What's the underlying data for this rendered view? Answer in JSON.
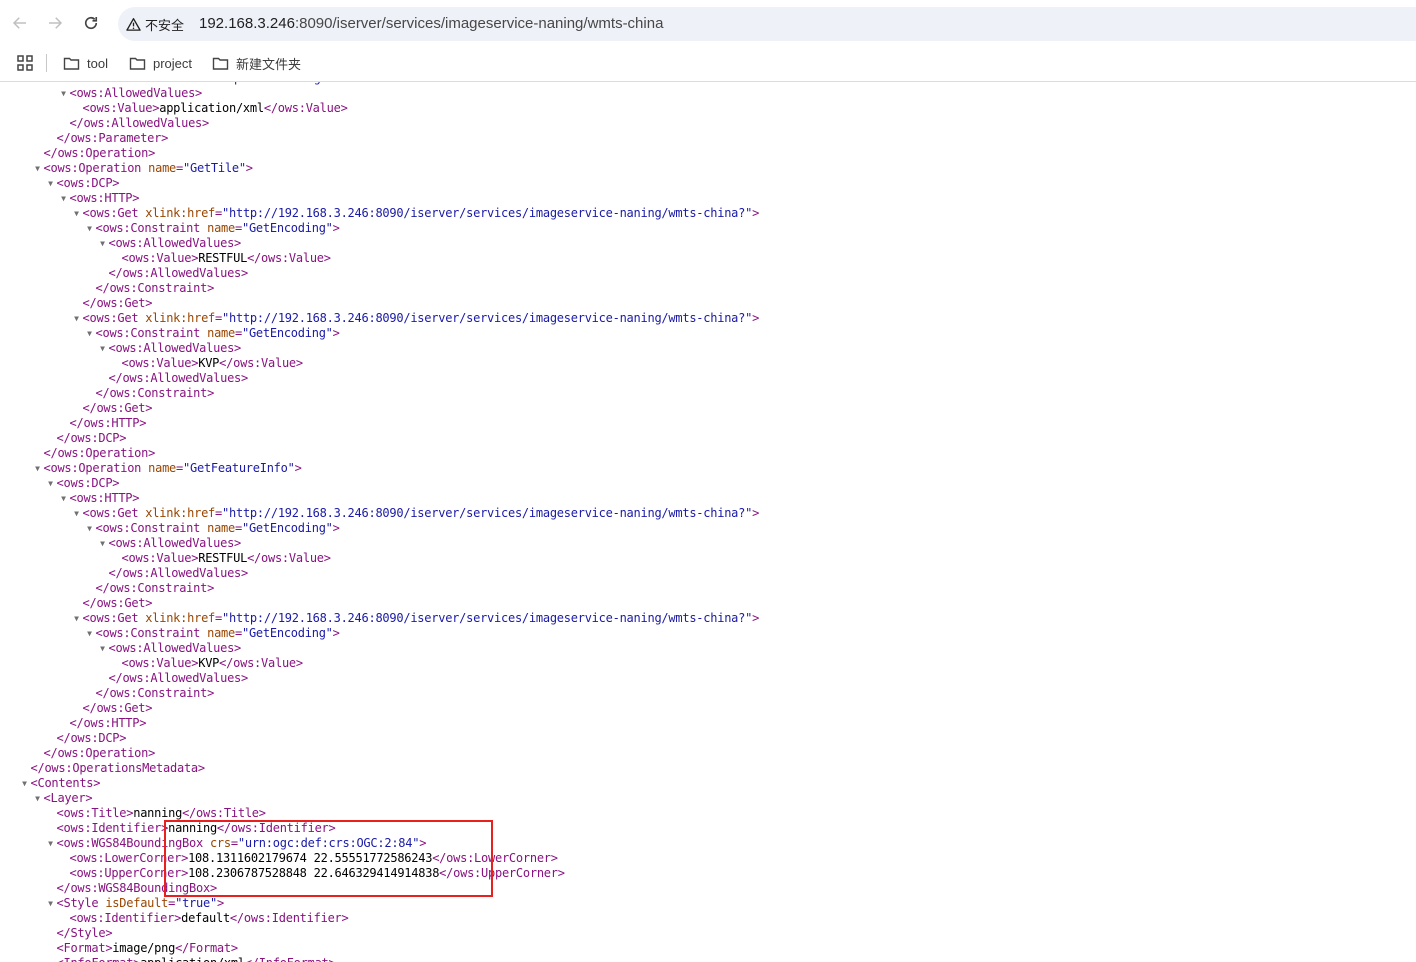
{
  "browser": {
    "security_label": "不安全",
    "url_host": "192.168.3.246",
    "url_path": ":8090/iserver/services/imageservice-naning/wmts-china",
    "bookmarks": [
      {
        "label": "tool"
      },
      {
        "label": "project"
      },
      {
        "label": "新建文件夹"
      }
    ]
  },
  "xml_lines": [
    {
      "indent": 5,
      "toggle": "",
      "parts": [
        [
          "tg",
          "<ows:Parameter "
        ],
        [
          "an",
          "name"
        ],
        [
          "tg",
          "="
        ],
        [
          "av",
          "\"RequestEncoding\""
        ],
        [
          "tg",
          ">"
        ]
      ]
    },
    {
      "indent": 5,
      "toggle": "▼",
      "parts": [
        [
          "tg",
          "<ows:AllowedValues>"
        ]
      ]
    },
    {
      "indent": 6,
      "toggle": "",
      "parts": [
        [
          "tg",
          "<ows:Value>"
        ],
        [
          "tx",
          "application/xml"
        ],
        [
          "tg",
          "</ows:Value>"
        ]
      ]
    },
    {
      "indent": 5,
      "toggle": "",
      "parts": [
        [
          "tg",
          "</ows:AllowedValues>"
        ]
      ]
    },
    {
      "indent": 4,
      "toggle": "",
      "parts": [
        [
          "tg",
          "</ows:Parameter>"
        ]
      ]
    },
    {
      "indent": 3,
      "toggle": "",
      "parts": [
        [
          "tg",
          "</ows:Operation>"
        ]
      ]
    },
    {
      "indent": 3,
      "toggle": "▼",
      "parts": [
        [
          "tg",
          "<ows:Operation "
        ],
        [
          "an",
          "name"
        ],
        [
          "tg",
          "="
        ],
        [
          "av",
          "\"GetTile\""
        ],
        [
          "tg",
          ">"
        ]
      ]
    },
    {
      "indent": 4,
      "toggle": "▼",
      "parts": [
        [
          "tg",
          "<ows:DCP>"
        ]
      ]
    },
    {
      "indent": 5,
      "toggle": "▼",
      "parts": [
        [
          "tg",
          "<ows:HTTP>"
        ]
      ]
    },
    {
      "indent": 6,
      "toggle": "▼",
      "parts": [
        [
          "tg",
          "<ows:Get "
        ],
        [
          "an",
          "xlink:href"
        ],
        [
          "tg",
          "="
        ],
        [
          "av",
          "\"http://192.168.3.246:8090/iserver/services/imageservice-naning/wmts-china?\""
        ],
        [
          "tg",
          ">"
        ]
      ]
    },
    {
      "indent": 7,
      "toggle": "▼",
      "parts": [
        [
          "tg",
          "<ows:Constraint "
        ],
        [
          "an",
          "name"
        ],
        [
          "tg",
          "="
        ],
        [
          "av",
          "\"GetEncoding\""
        ],
        [
          "tg",
          ">"
        ]
      ]
    },
    {
      "indent": 8,
      "toggle": "▼",
      "parts": [
        [
          "tg",
          "<ows:AllowedValues>"
        ]
      ]
    },
    {
      "indent": 9,
      "toggle": "",
      "parts": [
        [
          "tg",
          "<ows:Value>"
        ],
        [
          "tx",
          "RESTFUL"
        ],
        [
          "tg",
          "</ows:Value>"
        ]
      ]
    },
    {
      "indent": 8,
      "toggle": "",
      "parts": [
        [
          "tg",
          "</ows:AllowedValues>"
        ]
      ]
    },
    {
      "indent": 7,
      "toggle": "",
      "parts": [
        [
          "tg",
          "</ows:Constraint>"
        ]
      ]
    },
    {
      "indent": 6,
      "toggle": "",
      "parts": [
        [
          "tg",
          "</ows:Get>"
        ]
      ]
    },
    {
      "indent": 6,
      "toggle": "▼",
      "parts": [
        [
          "tg",
          "<ows:Get "
        ],
        [
          "an",
          "xlink:href"
        ],
        [
          "tg",
          "="
        ],
        [
          "av",
          "\"http://192.168.3.246:8090/iserver/services/imageservice-naning/wmts-china?\""
        ],
        [
          "tg",
          ">"
        ]
      ]
    },
    {
      "indent": 7,
      "toggle": "▼",
      "parts": [
        [
          "tg",
          "<ows:Constraint "
        ],
        [
          "an",
          "name"
        ],
        [
          "tg",
          "="
        ],
        [
          "av",
          "\"GetEncoding\""
        ],
        [
          "tg",
          ">"
        ]
      ]
    },
    {
      "indent": 8,
      "toggle": "▼",
      "parts": [
        [
          "tg",
          "<ows:AllowedValues>"
        ]
      ]
    },
    {
      "indent": 9,
      "toggle": "",
      "parts": [
        [
          "tg",
          "<ows:Value>"
        ],
        [
          "tx",
          "KVP"
        ],
        [
          "tg",
          "</ows:Value>"
        ]
      ]
    },
    {
      "indent": 8,
      "toggle": "",
      "parts": [
        [
          "tg",
          "</ows:AllowedValues>"
        ]
      ]
    },
    {
      "indent": 7,
      "toggle": "",
      "parts": [
        [
          "tg",
          "</ows:Constraint>"
        ]
      ]
    },
    {
      "indent": 6,
      "toggle": "",
      "parts": [
        [
          "tg",
          "</ows:Get>"
        ]
      ]
    },
    {
      "indent": 5,
      "toggle": "",
      "parts": [
        [
          "tg",
          "</ows:HTTP>"
        ]
      ]
    },
    {
      "indent": 4,
      "toggle": "",
      "parts": [
        [
          "tg",
          "</ows:DCP>"
        ]
      ]
    },
    {
      "indent": 3,
      "toggle": "",
      "parts": [
        [
          "tg",
          "</ows:Operation>"
        ]
      ]
    },
    {
      "indent": 3,
      "toggle": "▼",
      "parts": [
        [
          "tg",
          "<ows:Operation "
        ],
        [
          "an",
          "name"
        ],
        [
          "tg",
          "="
        ],
        [
          "av",
          "\"GetFeatureInfo\""
        ],
        [
          "tg",
          ">"
        ]
      ]
    },
    {
      "indent": 4,
      "toggle": "▼",
      "parts": [
        [
          "tg",
          "<ows:DCP>"
        ]
      ]
    },
    {
      "indent": 5,
      "toggle": "▼",
      "parts": [
        [
          "tg",
          "<ows:HTTP>"
        ]
      ]
    },
    {
      "indent": 6,
      "toggle": "▼",
      "parts": [
        [
          "tg",
          "<ows:Get "
        ],
        [
          "an",
          "xlink:href"
        ],
        [
          "tg",
          "="
        ],
        [
          "av",
          "\"http://192.168.3.246:8090/iserver/services/imageservice-naning/wmts-china?\""
        ],
        [
          "tg",
          ">"
        ]
      ]
    },
    {
      "indent": 7,
      "toggle": "▼",
      "parts": [
        [
          "tg",
          "<ows:Constraint "
        ],
        [
          "an",
          "name"
        ],
        [
          "tg",
          "="
        ],
        [
          "av",
          "\"GetEncoding\""
        ],
        [
          "tg",
          ">"
        ]
      ]
    },
    {
      "indent": 8,
      "toggle": "▼",
      "parts": [
        [
          "tg",
          "<ows:AllowedValues>"
        ]
      ]
    },
    {
      "indent": 9,
      "toggle": "",
      "parts": [
        [
          "tg",
          "<ows:Value>"
        ],
        [
          "tx",
          "RESTFUL"
        ],
        [
          "tg",
          "</ows:Value>"
        ]
      ]
    },
    {
      "indent": 8,
      "toggle": "",
      "parts": [
        [
          "tg",
          "</ows:AllowedValues>"
        ]
      ]
    },
    {
      "indent": 7,
      "toggle": "",
      "parts": [
        [
          "tg",
          "</ows:Constraint>"
        ]
      ]
    },
    {
      "indent": 6,
      "toggle": "",
      "parts": [
        [
          "tg",
          "</ows:Get>"
        ]
      ]
    },
    {
      "indent": 6,
      "toggle": "▼",
      "parts": [
        [
          "tg",
          "<ows:Get "
        ],
        [
          "an",
          "xlink:href"
        ],
        [
          "tg",
          "="
        ],
        [
          "av",
          "\"http://192.168.3.246:8090/iserver/services/imageservice-naning/wmts-china?\""
        ],
        [
          "tg",
          ">"
        ]
      ]
    },
    {
      "indent": 7,
      "toggle": "▼",
      "parts": [
        [
          "tg",
          "<ows:Constraint "
        ],
        [
          "an",
          "name"
        ],
        [
          "tg",
          "="
        ],
        [
          "av",
          "\"GetEncoding\""
        ],
        [
          "tg",
          ">"
        ]
      ]
    },
    {
      "indent": 8,
      "toggle": "▼",
      "parts": [
        [
          "tg",
          "<ows:AllowedValues>"
        ]
      ]
    },
    {
      "indent": 9,
      "toggle": "",
      "parts": [
        [
          "tg",
          "<ows:Value>"
        ],
        [
          "tx",
          "KVP"
        ],
        [
          "tg",
          "</ows:Value>"
        ]
      ]
    },
    {
      "indent": 8,
      "toggle": "",
      "parts": [
        [
          "tg",
          "</ows:AllowedValues>"
        ]
      ]
    },
    {
      "indent": 7,
      "toggle": "",
      "parts": [
        [
          "tg",
          "</ows:Constraint>"
        ]
      ]
    },
    {
      "indent": 6,
      "toggle": "",
      "parts": [
        [
          "tg",
          "</ows:Get>"
        ]
      ]
    },
    {
      "indent": 5,
      "toggle": "",
      "parts": [
        [
          "tg",
          "</ows:HTTP>"
        ]
      ]
    },
    {
      "indent": 4,
      "toggle": "",
      "parts": [
        [
          "tg",
          "</ows:DCP>"
        ]
      ]
    },
    {
      "indent": 3,
      "toggle": "",
      "parts": [
        [
          "tg",
          "</ows:Operation>"
        ]
      ]
    },
    {
      "indent": 2,
      "toggle": "",
      "parts": [
        [
          "tg",
          "</ows:OperationsMetadata>"
        ]
      ]
    },
    {
      "indent": 2,
      "toggle": "▼",
      "parts": [
        [
          "tg",
          "<Contents>"
        ]
      ]
    },
    {
      "indent": 3,
      "toggle": "▼",
      "parts": [
        [
          "tg",
          "<Layer>"
        ]
      ]
    },
    {
      "indent": 4,
      "toggle": "",
      "parts": [
        [
          "tg",
          "<ows:Title>"
        ],
        [
          "tx",
          "nanning"
        ],
        [
          "tg",
          "</ows:Title>"
        ]
      ]
    },
    {
      "indent": 4,
      "toggle": "",
      "parts": [
        [
          "tg",
          "<ows:Identifier>"
        ],
        [
          "tx",
          "nanning"
        ],
        [
          "tg",
          "</ows:Identifier>"
        ]
      ]
    },
    {
      "indent": 4,
      "toggle": "▼",
      "parts": [
        [
          "tg",
          "<ows:WGS84BoundingBox "
        ],
        [
          "an",
          "crs"
        ],
        [
          "tg",
          "="
        ],
        [
          "av",
          "\"urn:ogc:def:crs:OGC:2:84\""
        ],
        [
          "tg",
          ">"
        ]
      ]
    },
    {
      "indent": 5,
      "toggle": "",
      "parts": [
        [
          "tg",
          "<ows:LowerCorner>"
        ],
        [
          "tx",
          "108.1311602179674 22.55551772586243"
        ],
        [
          "tg",
          "</ows:LowerCorner>"
        ]
      ]
    },
    {
      "indent": 5,
      "toggle": "",
      "parts": [
        [
          "tg",
          "<ows:UpperCorner>"
        ],
        [
          "tx",
          "108.2306787528848 22.646329414914838"
        ],
        [
          "tg",
          "</ows:UpperCorner>"
        ]
      ]
    },
    {
      "indent": 4,
      "toggle": "",
      "parts": [
        [
          "tg",
          "</ows:WGS84BoundingBox>"
        ]
      ]
    },
    {
      "indent": 4,
      "toggle": "▼",
      "parts": [
        [
          "tg",
          "<Style "
        ],
        [
          "an",
          "isDefault"
        ],
        [
          "tg",
          "="
        ],
        [
          "av",
          "\"true\""
        ],
        [
          "tg",
          ">"
        ]
      ]
    },
    {
      "indent": 5,
      "toggle": "",
      "parts": [
        [
          "tg",
          "<ows:Identifier>"
        ],
        [
          "tx",
          "default"
        ],
        [
          "tg",
          "</ows:Identifier>"
        ]
      ]
    },
    {
      "indent": 4,
      "toggle": "",
      "parts": [
        [
          "tg",
          "</Style>"
        ]
      ]
    },
    {
      "indent": 4,
      "toggle": "",
      "parts": [
        [
          "tg",
          "<Format>"
        ],
        [
          "tx",
          "image/png"
        ],
        [
          "tg",
          "</Format>"
        ]
      ]
    },
    {
      "indent": 4,
      "toggle": "",
      "parts": [
        [
          "tg",
          "<InfoFormat>"
        ],
        [
          "tx",
          "application/xml"
        ],
        [
          "tg",
          "</InfoFormat>"
        ]
      ]
    }
  ]
}
